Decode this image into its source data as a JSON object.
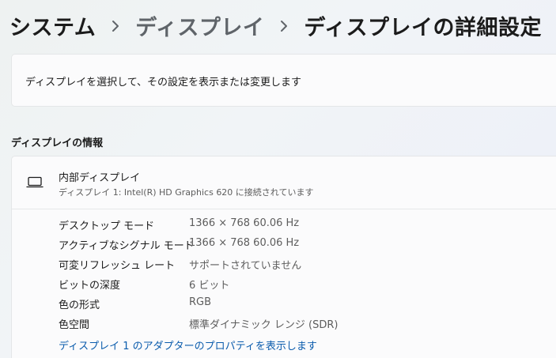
{
  "breadcrumb": {
    "root": "システム",
    "parent": "ディスプレイ",
    "current": "ディスプレイの詳細設定"
  },
  "select_card": {
    "label": "ディスプレイを選択して、その設定を表示または変更します"
  },
  "display_info": {
    "heading": "ディスプレイの情報",
    "display_name": "内部ディスプレイ",
    "display_subtitle": "ディスプレイ 1: Intel(R) HD Graphics 620 に接続されています",
    "properties": [
      {
        "label": "デスクトップ モード",
        "value": "1366 × 768 60.06 Hz"
      },
      {
        "label": "アクティブなシグナル モード",
        "value": "1366 × 768 60.06 Hz"
      },
      {
        "label": "可変リフレッシュ レート",
        "value": "サポートされていません"
      },
      {
        "label": "ビットの深度",
        "value": "6 ビット"
      },
      {
        "label": "色の形式",
        "value": "RGB"
      },
      {
        "label": "色空間",
        "value": "標準ダイナミック レンジ (SDR)"
      }
    ],
    "adapter_link": "ディスプレイ 1 のアダプターのプロパティを表示します"
  },
  "icons": {
    "chevron": "chevron-right-icon",
    "display": "laptop-icon"
  },
  "colors": {
    "link": "#0b5cad",
    "secondary_text": "#5d5d5d",
    "breadcrumb_parent": "#5f6469"
  }
}
